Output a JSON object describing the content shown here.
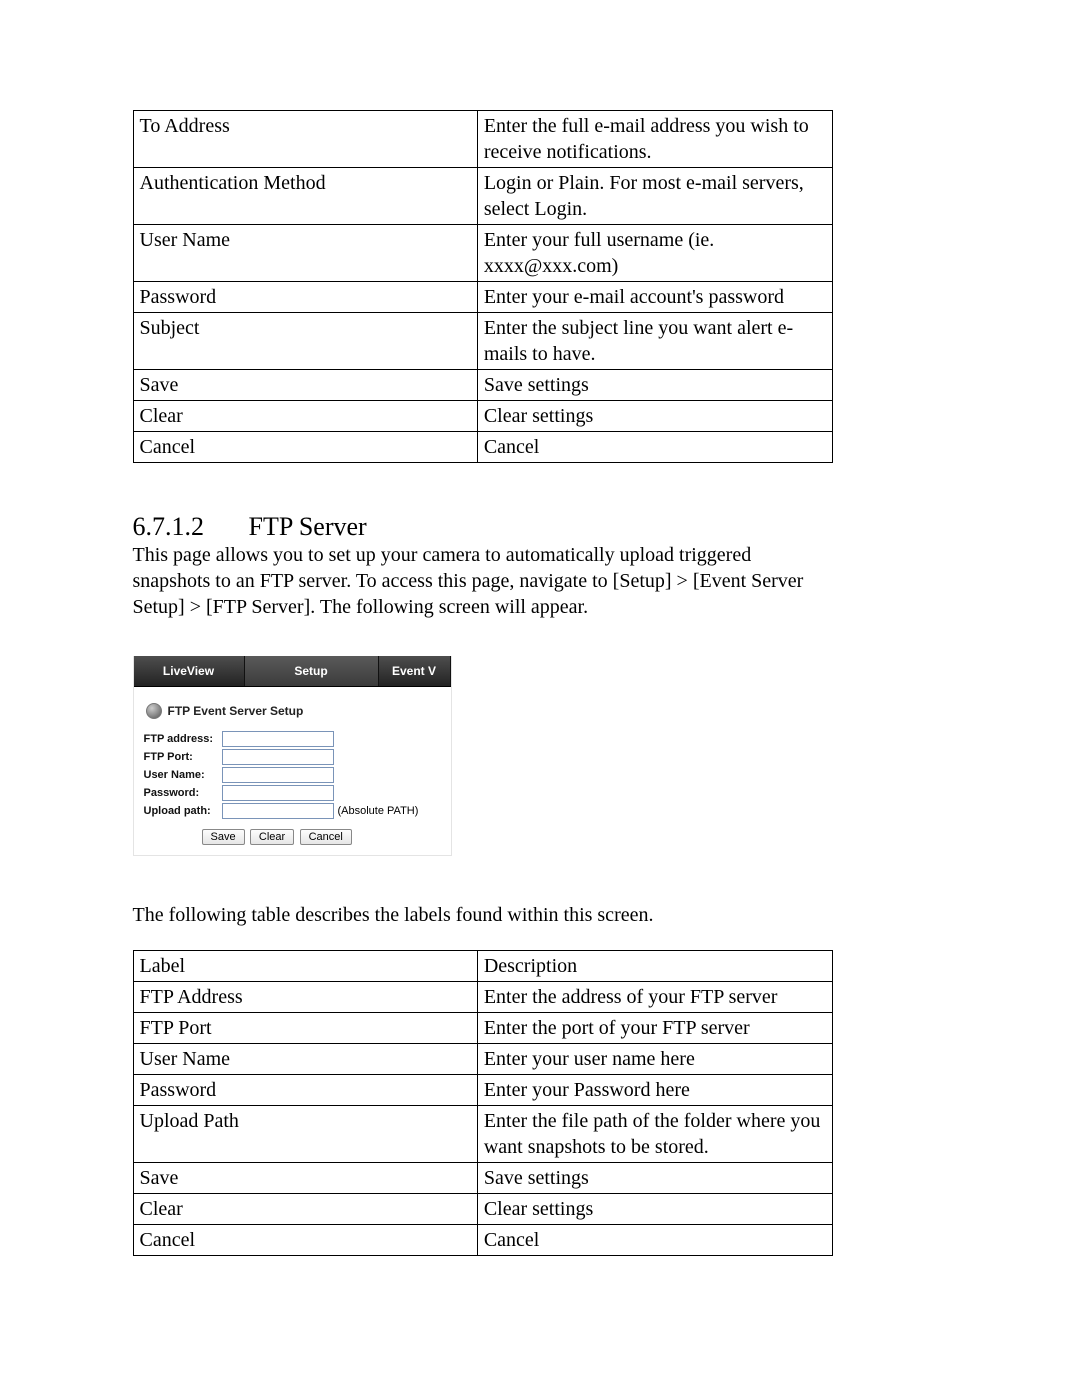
{
  "table1": {
    "rows": [
      {
        "label": "To Address",
        "desc": "Enter the full e-mail address you wish to receive notifications."
      },
      {
        "label": "Authentication Method",
        "desc": "Login or Plain. For most e-mail servers, select Login."
      },
      {
        "label": "User Name",
        "desc": "Enter your full username (ie. xxxx@xxx.com)"
      },
      {
        "label": "Password",
        "desc": "Enter your e-mail account's password"
      },
      {
        "label": "Subject",
        "desc": "Enter the subject line you want alert e-mails to have."
      },
      {
        "label": "Save",
        "desc": "Save settings"
      },
      {
        "label": "Clear",
        "desc": "Clear settings"
      },
      {
        "label": "Cancel",
        "desc": "Cancel"
      }
    ]
  },
  "section": {
    "number": "6.7.1.2",
    "title": "FTP Server",
    "intro": "This page allows you to set up your camera to automatically upload triggered snapshots to an FTP server.  To access this page, navigate to [Setup] > [Event Server Setup] > [FTP Server]. The following screen will appear.",
    "table_intro": "The following table describes the labels found within this screen."
  },
  "ui": {
    "tabs": {
      "live": "LiveView",
      "setup": "Setup",
      "event": "Event V"
    },
    "panel_title": "FTP Event Server Setup",
    "form": {
      "ftp_address": "FTP address:",
      "ftp_port": "FTP Port:",
      "user_name": "User Name:",
      "password": "Password:",
      "upload_path": "Upload path:",
      "upload_hint": "(Absolute PATH)"
    },
    "buttons": {
      "save": "Save",
      "clear": "Clear",
      "cancel": "Cancel"
    }
  },
  "table2": {
    "header": {
      "label": "Label",
      "desc": "Description"
    },
    "rows": [
      {
        "label": "FTP Address",
        "desc": "Enter the address of your FTP server"
      },
      {
        "label": "FTP Port",
        "desc": "Enter the port of  your FTP server"
      },
      {
        "label": "User Name",
        "desc": "Enter your user name here"
      },
      {
        "label": "Password",
        "desc": "Enter your Password here"
      },
      {
        "label": "Upload Path",
        "desc": "Enter the file path of the folder where you want snapshots to be stored."
      },
      {
        "label": "Save",
        "desc": "Save settings"
      },
      {
        "label": "Clear",
        "desc": "Clear settings"
      },
      {
        "label": "Cancel",
        "desc": "Cancel"
      }
    ]
  }
}
